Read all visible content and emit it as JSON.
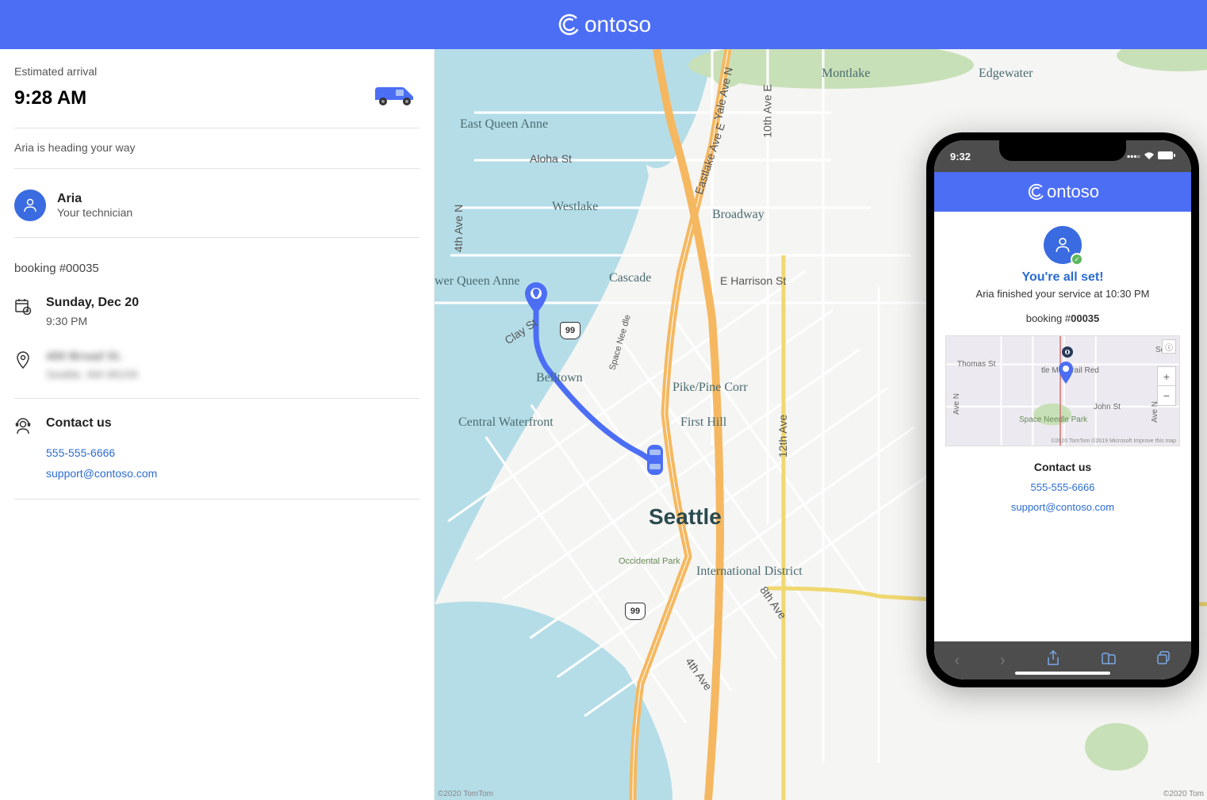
{
  "brand": "ontoso",
  "arrival": {
    "label": "Estimated arrival",
    "time": "9:28 AM",
    "status": "Aria is heading your way"
  },
  "technician": {
    "name": "Aria",
    "role": "Your technician"
  },
  "booking": {
    "label": "booking #00035",
    "date": "Sunday, Dec 20",
    "time": "9:30 PM",
    "address_line1": "400 Broad St.",
    "address_line2": "Seattle, WA 98109"
  },
  "contact": {
    "title": "Contact us",
    "phone": "555-555-6666",
    "email": "support@contoso.com"
  },
  "map": {
    "city": "Seattle",
    "labels": {
      "montlake": "Montlake",
      "edgewater": "Edgewater",
      "eqa": "East Queen Anne",
      "westlake": "Westlake",
      "broadway": "Broadway",
      "lqa": "wer Queen Anne",
      "cascade": "Cascade",
      "belltown": "Belltown",
      "cwaterfront": "Central Waterfront",
      "pikepine": "Pike/Pine Corr",
      "firsthill": "First Hill",
      "intldistrict": "International District",
      "eharrison": "E Harrison St",
      "aloha": "Aloha St",
      "yale": "Yale Ave N",
      "space": "Space Nee dle",
      "eastlake": "Eastlake Ave E",
      "tenth": "10th Ave E",
      "twelfth": "12th Ave",
      "fourth": "4th Ave N",
      "fourtha": "4th Ave",
      "clay": "Clay St",
      "eighth": "8th Ave",
      "occidental": "Occidental Park",
      "hwy99a": "99",
      "hwy99b": "99"
    },
    "attr_left": "©2020 TomTom",
    "attr_right": "©2020 Tom"
  },
  "phone": {
    "time": "9:32",
    "brand": "ontoso",
    "title": "You're all set!",
    "desc": "Aria finished your service at 10:30 PM",
    "booking_prefix": "booking #",
    "booking_num": "00035",
    "map_labels": {
      "thomas": "Thomas St",
      "monorail": "tle Monorail Red",
      "spaceneedle": "Space Needle Park",
      "john": "John St",
      "seattle": "Seattl",
      "ave_n": "Ave N",
      "ave_n2": "Ave N"
    },
    "zoom_plus": "+",
    "zoom_minus": "−",
    "map_attr": "©2020 TomTom ©2019 Microsoft  Improve this map",
    "contact_title": "Contact us",
    "phone_num": "555-555-6666",
    "email": "support@contoso.com"
  }
}
